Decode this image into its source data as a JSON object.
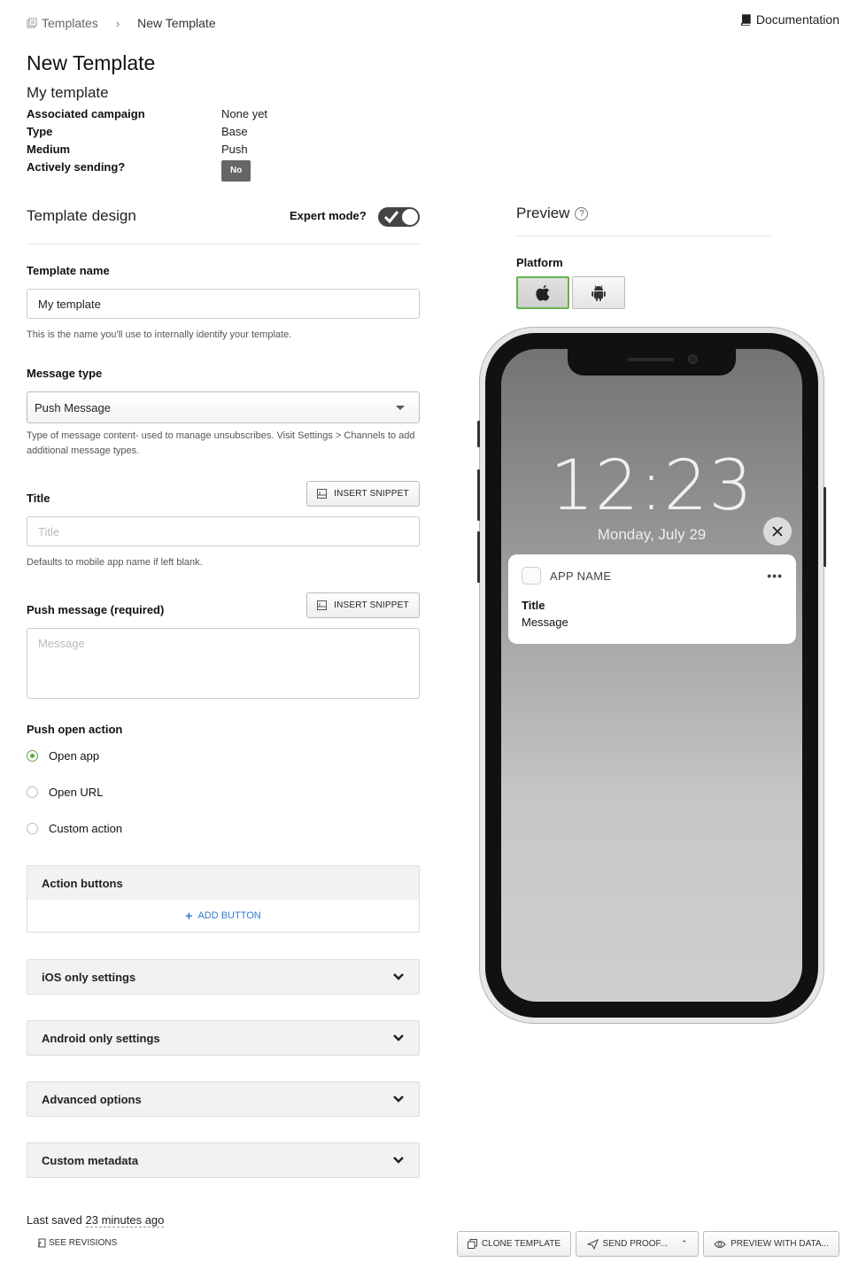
{
  "breadcrumb": {
    "root": "Templates",
    "current": "New Template"
  },
  "header": {
    "documentation": "Documentation"
  },
  "page": {
    "title": "New Template",
    "template_heading": "My template"
  },
  "meta": [
    {
      "key": "Associated campaign",
      "value": "None yet"
    },
    {
      "key": "Type",
      "value": "Base"
    },
    {
      "key": "Medium",
      "value": "Push"
    },
    {
      "key": "Actively sending?",
      "value": "No"
    }
  ],
  "design": {
    "title": "Template design",
    "expert_mode_label": "Expert mode?",
    "expert_mode_on": true
  },
  "template_name": {
    "label": "Template name",
    "value": "My template",
    "help": "This is the name you'll use to internally identify your template."
  },
  "message_type": {
    "label": "Message type",
    "value": "Push Message",
    "help": "Type of message content- used to manage unsubscribes. Visit Settings > Channels to add additional message types."
  },
  "title_field": {
    "label": "Title",
    "placeholder": "Title",
    "help": "Defaults to mobile app name if left blank.",
    "snippet": "INSERT SNIPPET"
  },
  "push_message": {
    "label": "Push message (required)",
    "placeholder": "Message",
    "snippet": "INSERT SNIPPET"
  },
  "open_action": {
    "label": "Push open action",
    "options": [
      "Open app",
      "Open URL",
      "Custom action"
    ],
    "selected": "Open app"
  },
  "panels": {
    "action_buttons": "Action buttons",
    "add_button": "ADD BUTTON",
    "ios": "iOS only settings",
    "android": "Android only settings",
    "advanced": "Advanced options",
    "custom_metadata": "Custom metadata"
  },
  "footer": {
    "last_saved_prefix": "Last saved",
    "last_saved_time": "23 minutes ago",
    "see_revisions": "SEE REVISIONS",
    "clone": "CLONE TEMPLATE",
    "send_proof": "SEND PROOF...",
    "preview_data": "PREVIEW WITH DATA..."
  },
  "preview": {
    "title": "Preview",
    "platform_label": "Platform",
    "selected_platform": "ios",
    "time": "12:23",
    "date": "Monday, July 29",
    "notification": {
      "app_name": "APP NAME",
      "title": "Title",
      "message": "Message"
    }
  },
  "colors": {
    "accent_green": "#5aa845",
    "link_blue": "#2f7bd1",
    "toggle_dark": "#444444"
  }
}
